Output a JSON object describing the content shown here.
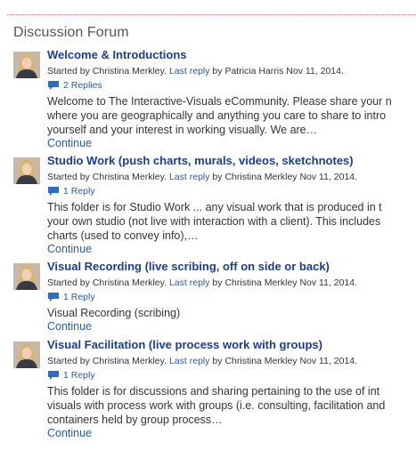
{
  "forum": {
    "title": "Discussion Forum"
  },
  "labels": {
    "started_by": "Started by",
    "last_reply": "Last reply",
    "by": "by",
    "continue": "Continue"
  },
  "topics": [
    {
      "title": "Welcome & Introductions",
      "author": "Christina Merkley.",
      "last_reply_by": "Patricia Harris",
      "date": "Nov 11, 2014.",
      "replies": "2 Replies",
      "excerpt": [
        "Welcome to The Interactive-Visuals eCommunity.  Please share your n",
        "where you are geographically and anything you care to share to intro",
        "yourself and your interest in working visually. We are…"
      ]
    },
    {
      "title": "Studio Work (push charts, murals, videos, sketchnotes)",
      "author": "Christina Merkley.",
      "last_reply_by": "Christina Merkley",
      "date": "Nov 11, 2014.",
      "replies": "1 Reply",
      "excerpt": [
        "This folder is for Studio Work ... any visual work that is produced in t",
        "your own studio (not live with interaction with a client). This includes",
        "charts (used to convey info),…"
      ]
    },
    {
      "title": "Visual Recording (live scribing, off on side or back)",
      "author": "Christina Merkley.",
      "last_reply_by": "Christina Merkley",
      "date": "Nov 11, 2014.",
      "replies": "1 Reply",
      "excerpt": [
        "Visual Recording (scribing)"
      ]
    },
    {
      "title": "Visual Facilitation (live process work with groups)",
      "author": "Christina Merkley.",
      "last_reply_by": "Christina Merkley",
      "date": "Nov 11, 2014.",
      "replies": "1 Reply",
      "excerpt": [
        "This folder is for discussions and sharing pertaining to the use of int",
        "visuals with process work with groups (i.e. consulting, facilitation and",
        "containers held by group process…"
      ]
    }
  ],
  "icons": {
    "avatar": "avatar-photo-icon",
    "replies": "comment-bubble-icon"
  },
  "colors": {
    "link": "#2c5aa0",
    "title_link": "#1a3d8f",
    "rule": "#e07777",
    "comment_icon": "#2b6cc4"
  }
}
